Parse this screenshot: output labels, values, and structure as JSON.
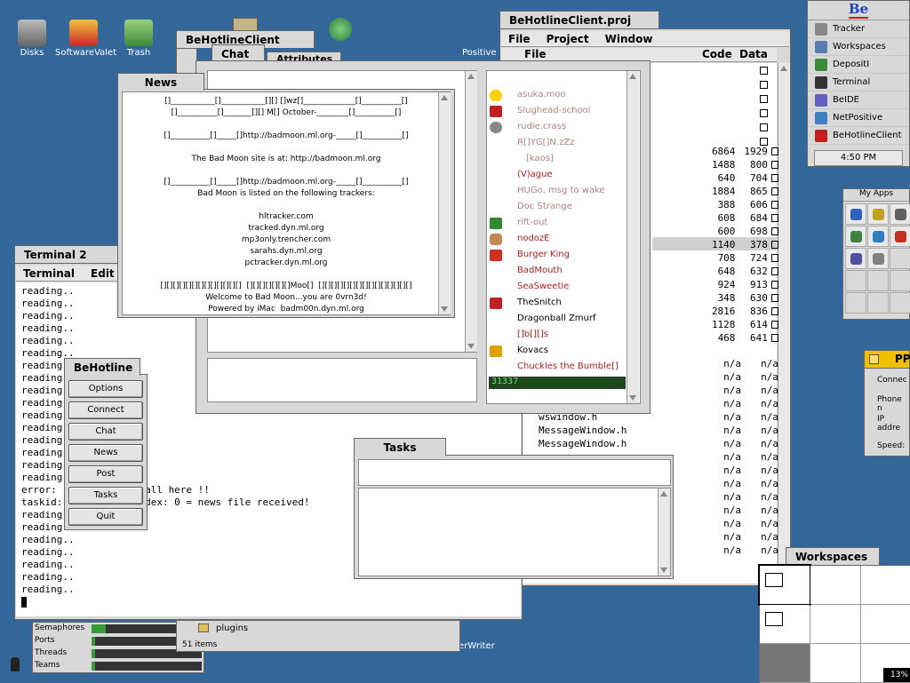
{
  "desktop_icons": [
    {
      "label": "Disks",
      "icon": "disks-icon"
    },
    {
      "label": "SoftwareValet",
      "icon": "software-valet-icon"
    },
    {
      "label": "Trash",
      "icon": "trash-icon"
    }
  ],
  "deskbar": {
    "logo": "Be",
    "items": [
      "Tracker",
      "Workspaces",
      "DepositI",
      "Terminal",
      "BeIDE",
      "NetPositive",
      "BeHotlineClient"
    ],
    "clock": "4:50 PM"
  },
  "my_apps": {
    "title": "My Apps"
  },
  "project": {
    "title": "BeHotlineClient.proj",
    "menu": [
      "File",
      "Project",
      "Window"
    ],
    "columns": [
      "File",
      "Code",
      "Data"
    ],
    "rows": [
      {
        "code": "6864",
        "data": "1929"
      },
      {
        "code": "1488",
        "data": "800"
      },
      {
        "code": "640",
        "data": "704"
      },
      {
        "code": "1884",
        "data": "865"
      },
      {
        "code": "388",
        "data": "606"
      },
      {
        "code": "608",
        "data": "684"
      },
      {
        "code": "600",
        "data": "698"
      },
      {
        "code": "1140",
        "data": "378"
      },
      {
        "code": "708",
        "data": "724"
      },
      {
        "code": "648",
        "data": "632"
      },
      {
        "code": "924",
        "data": "913"
      },
      {
        "code": "348",
        "data": "630"
      },
      {
        "code": "2816",
        "data": "836"
      },
      {
        "code": "1128",
        "data": "614"
      },
      {
        "code": "468",
        "data": "641"
      }
    ],
    "files_visible": [
      "wswindow.h",
      "MessageWindow.h",
      "MessageWindow.h"
    ],
    "na": "n/a"
  },
  "attributes_tab": "Attributes",
  "behotline_tab": "BeHotlineClient",
  "chat": {
    "title": "Chat",
    "users": [
      {
        "name": "asuka.moo",
        "color": "#b08080",
        "icon": "frog-icon"
      },
      {
        "name": "Slughead-school",
        "color": "#b08080",
        "icon": "hotline-h-icon"
      },
      {
        "name": "rudie.crass",
        "color": "#b08080",
        "icon": "skull-icon"
      },
      {
        "name": "R[]YG[]N.zZz",
        "color": "#b08080",
        "icon": ""
      },
      {
        "name": "[kaos]",
        "color": "#b08080",
        "icon": ""
      },
      {
        "name": "(V)ague",
        "color": "#b02020",
        "icon": ""
      },
      {
        "name": "HUGo, msg to wake",
        "color": "#b08080",
        "icon": ""
      },
      {
        "name": "Doc Strange",
        "color": "#b08080",
        "icon": ""
      },
      {
        "name": "rift-out",
        "color": "#b08080",
        "icon": "leaf-icon"
      },
      {
        "name": "nodozE",
        "color": "#b02020",
        "icon": "face-icon"
      },
      {
        "name": "Burger King",
        "color": "#b02020",
        "icon": "burger-king-icon"
      },
      {
        "name": "BadMouth",
        "color": "#b02020",
        "icon": ""
      },
      {
        "name": "SeaSweetie",
        "color": "#b02020",
        "icon": ""
      },
      {
        "name": "TheSnitch",
        "color": "#000000",
        "icon": "hotline-h-icon"
      },
      {
        "name": "Dragonball Zmurf",
        "color": "#000000",
        "icon": ""
      },
      {
        "name": "[]b[][]s",
        "color": "#b02020",
        "icon": ""
      },
      {
        "name": "Kovacs",
        "color": "#000000",
        "icon": "star-trek-icon"
      },
      {
        "name": "Chuckles the Bumble[]",
        "color": "#b02020",
        "icon": ""
      }
    ],
    "status_num": "31337"
  },
  "news": {
    "title": "News",
    "lines": [
      "[]___________[]___________[][] []wz[]_____________[]__________[]",
      "[]__________[]_______[][] M[] October-________[]__________[]",
      "",
      "[]__________[]_____[]http://badmoon.ml.org-_____[]__________[]",
      "",
      "The Bad Moon site is at: http://badmoon.ml.org",
      "",
      "[]__________[]_____[]http://badmoon.ml.org-_____[]__________[]",
      "Bad Moon is listed on the following trackers:",
      "",
      "hltracker.com",
      "tracked.dyn.ml.org",
      "mp3only.trencher.com",
      "sarahs.dyn.ml.org",
      "pctracker.dyn.ml.org",
      "",
      "[][][][][][][][][][][][][]  [][][][][][][]Moo[]  [][][][][][][][][][][][][][][]",
      "Welcome to Bad Moon...you are 0vrn3d!",
      "Powered by iMac  badm00n.dyn.ml.org"
    ]
  },
  "terminal": {
    "title": "Terminal 2",
    "menu": [
      "Terminal",
      "Edit"
    ],
    "lines": [
      "reading..",
      "reading..",
      "reading..",
      "reading..",
      "reading..",
      "reading..",
      "reading..",
      "reading..",
      "reading..",
      "reading..",
      "reading..",
      "reading..",
      "reading..",
      "reading..",
      "reading..",
      "reading..",
      "error:               all here !!",
      "taskid:             ndex: 0 = news file received!",
      "reading..",
      "reading..",
      "reading..",
      "reading..",
      "reading..",
      "reading..",
      "reading.."
    ]
  },
  "behotline": {
    "title": "BeHotline",
    "buttons": [
      "Options",
      "Connect",
      "Chat",
      "News",
      "Post",
      "Tasks",
      "Quit"
    ]
  },
  "tasks": {
    "title": "Tasks"
  },
  "pp": {
    "title": "PP",
    "connect": "Connec",
    "phone": "Phone n",
    "ip": "IP addre",
    "speed": "Speed:"
  },
  "workspaces": {
    "title": "Workspaces"
  },
  "pulse": {
    "rows": [
      "Semaphores",
      "Ports",
      "Threads",
      "Teams"
    ]
  },
  "tracker_window": {
    "file": "plugins",
    "count": "51 items"
  },
  "netpositive": {
    "label": "Positive"
  },
  "writer_label": "erWriter",
  "cpu": "13%"
}
